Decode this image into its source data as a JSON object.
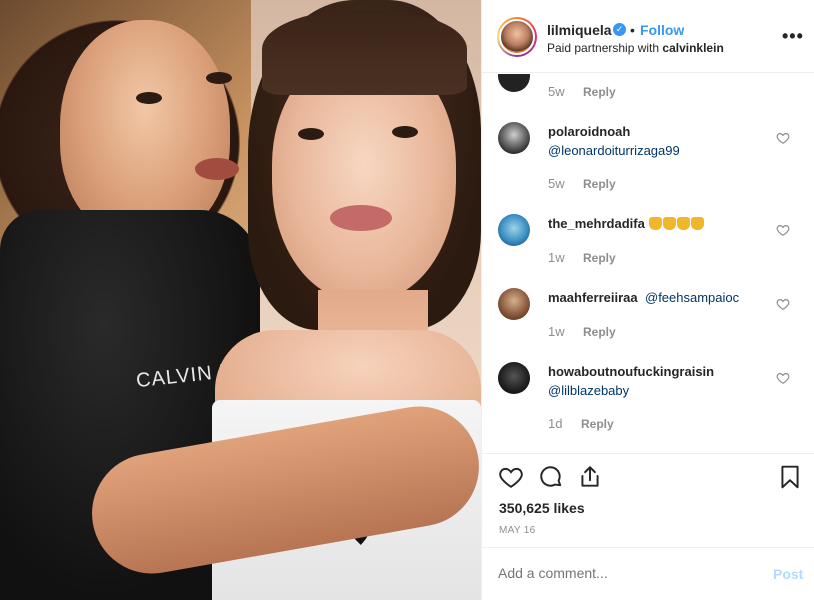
{
  "post": {
    "username": "lilmiquela",
    "follow_label": "Follow",
    "dot": "•",
    "partnership_prefix": "Paid partnership with",
    "partner": "calvinklein",
    "more_label": "•••",
    "photo_shirt_text": "CALVIN K"
  },
  "comments": [
    {
      "user": "",
      "text": "",
      "time": "5w",
      "reply": "Reply"
    },
    {
      "user": "polaroidnoah",
      "text": "@leonardoiturrizaga99",
      "time": "5w",
      "reply": "Reply"
    },
    {
      "user": "the_mehrdadifa",
      "text": "",
      "time": "1w",
      "reply": "Reply"
    },
    {
      "user": "maahferreiiraa",
      "text": "@feehsampaioc",
      "time": "1w",
      "reply": "Reply"
    },
    {
      "user": "howaboutnoufuckingraisin",
      "text": "@lilblazebaby",
      "time": "1d",
      "reply": "Reply"
    }
  ],
  "stats": {
    "likes": "350,625 likes",
    "date": "MAY 16"
  },
  "composer": {
    "placeholder": "Add a comment...",
    "post_label": "Post"
  },
  "icons": {
    "verified": "verified-badge-icon",
    "heart": "heart-icon",
    "comment": "comment-icon",
    "share": "share-icon",
    "save": "bookmark-icon",
    "more": "more-options-icon"
  },
  "colors": {
    "link": "#3897f0",
    "mention": "#003569",
    "muted": "#8e8e8e",
    "post_disabled": "#b3dbff"
  }
}
